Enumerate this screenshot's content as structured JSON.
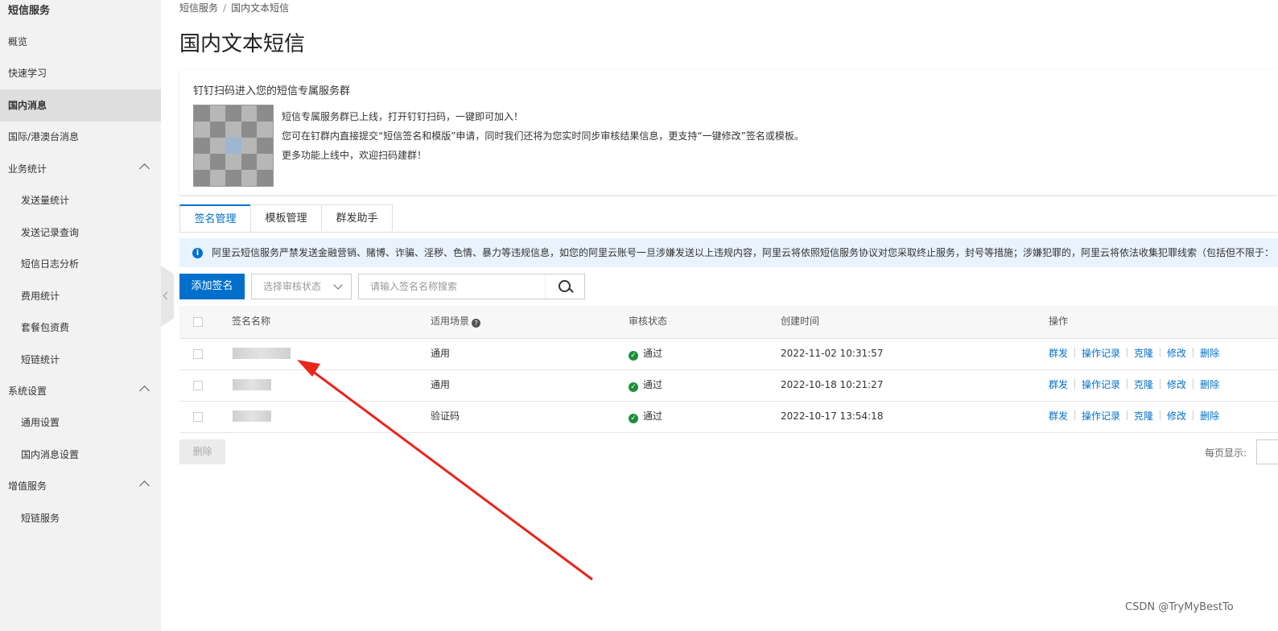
{
  "sidebar": {
    "title": "短信服务",
    "items": [
      {
        "label": "概览"
      },
      {
        "label": "快速学习"
      },
      {
        "label": "国内消息",
        "active": true
      },
      {
        "label": "国际/港澳台消息"
      },
      {
        "label": "业务统计",
        "group": true
      },
      {
        "label": "发送量统计"
      },
      {
        "label": "发送记录查询"
      },
      {
        "label": "短信日志分析"
      },
      {
        "label": "费用统计"
      },
      {
        "label": "套餐包资费"
      },
      {
        "label": "短链统计"
      },
      {
        "label": "系统设置",
        "group": true
      },
      {
        "label": "通用设置"
      },
      {
        "label": "国内消息设置"
      },
      {
        "label": "增值服务",
        "group": true
      },
      {
        "label": "短链服务"
      }
    ]
  },
  "breadcrumb": {
    "root": "短信服务",
    "separator": "/",
    "current": "国内文本短信"
  },
  "page_title": "国内文本短信",
  "banner": {
    "title": "钉钉扫码进入您的短信专属服务群",
    "lines": [
      "短信专属服务群已上线，打开钉钉扫码，一键即可加入！",
      "您可在钉群内直接提交“短信签名和模版”申请，同时我们还将为您实时同步审核结果信息，更支持“一键修改”签名或模板。",
      "更多功能上线中，欢迎扫码建群！"
    ]
  },
  "tabs": [
    {
      "label": "签名管理",
      "active": true
    },
    {
      "label": "模板管理"
    },
    {
      "label": "群发助手"
    }
  ],
  "notice": {
    "icon": "info-icon",
    "text": "阿里云短信服务严禁发送金融营销、赌博、诈骗、淫秽、色情、暴力等违规信息，如您的阿里云账号一旦涉嫌发送以上违规内容，阿里云将依照短信服务协议对您采取终止服务，封号等措施；涉嫌犯罪的，阿里云将依法收集犯罪线索（包括但不限于："
  },
  "toolbar": {
    "add_label": "添加签名",
    "status_select": "选择审核状态",
    "search_placeholder": "请输入签名名称搜索"
  },
  "table": {
    "headers": {
      "name": "签名名称",
      "scene": "适用场景",
      "status": "审核状态",
      "created": "创建时间",
      "ops": "操作"
    },
    "rows": [
      {
        "scene": "通用",
        "status": "通过",
        "created": "2022-11-02 10:31:57"
      },
      {
        "scene": "通用",
        "status": "通过",
        "created": "2022-10-18 10:21:27"
      },
      {
        "scene": "验证码",
        "status": "通过",
        "created": "2022-10-17 13:54:18"
      }
    ],
    "ops": [
      "群发",
      "操作记录",
      "克隆",
      "修改",
      "删除"
    ]
  },
  "footer": {
    "delete_label": "删除",
    "per_page_label": "每页显示:"
  },
  "watermark": "CSDN @TryMyBestTo",
  "colors": {
    "primary": "#0070cc",
    "success": "#1e8e3e",
    "annotation_arrow": "#e8261c"
  }
}
